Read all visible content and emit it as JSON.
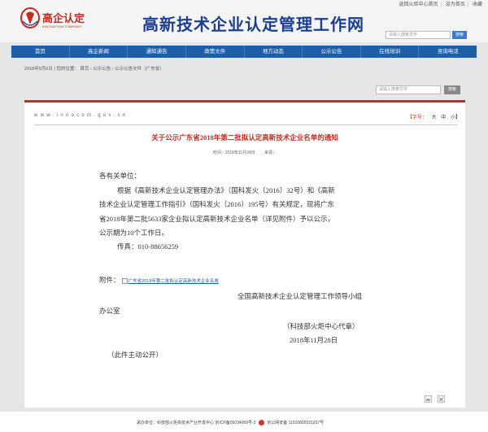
{
  "header": {
    "logo_text": "高企认定",
    "logo_sub": "INNOVATION COMPANY",
    "site_title": "高新技术企业认定管理工作网",
    "toplinks": [
      "返回火炬中心首页",
      "设为首页",
      "收藏"
    ],
    "search_placeholder": "请输入搜索文字",
    "search_button": "搜索"
  },
  "nav": {
    "items": [
      "首页",
      "高企新闻",
      "通知通告",
      "政策文件",
      "地方动态",
      "公示公告",
      "在线培训",
      "咨询电话"
    ]
  },
  "breadcrumb": "2018年5月6日 | 您的位置： 首页 › 公示公告 › 公示公告文件（广东省）",
  "sidebar_search": {
    "placeholder": "请输入搜索文字",
    "button": "搜索"
  },
  "article": {
    "domain": "w w w . i n n o c o m . g o v . c n",
    "fontsize_label": "【字号：",
    "fontsize_options": [
      "大",
      "中",
      "小】"
    ],
    "title": "关于公示广东省2018年第二批拟认定高新技术企业名单的通知",
    "time_label": "时间：2018年11月28日",
    "source_label": "来源：",
    "salutation": "各有关单位：",
    "paragraph": [
      "根据《高新技术企业认定管理办法》（国科发火〔2016〕32号）和《高新",
      "技术企业认定管理工作指引》（国科发火〔2016〕195号）有关规定，现将广东",
      "省2018年第二批5633家企业拟认定高新技术企业名单（详见附件）予以公示，",
      "公示期为10个工作日。"
    ],
    "fax": "传真：010-88656259",
    "attachment_label": "附件：",
    "attachment_link": "广东省2018年第二批拟认定高新技术企业名单",
    "signature_line1": "全国高新技术企业认定管理工作领导小组",
    "signature_line2": "办公室",
    "seal": "（科技部火炬中心代章）",
    "date": "2018年11月28日",
    "note": "（此件主动公开）"
  },
  "footer": {
    "text": "承办单位：科技部火炬高技术产业开发中心  京ICP备05034069号-3",
    "badge_text": "京公网安备 11010802021937号"
  },
  "colors": {
    "nav_blue": "#1d5ea9",
    "title_red": "#c62b20",
    "site_title_blue": "#1b3f8f"
  }
}
